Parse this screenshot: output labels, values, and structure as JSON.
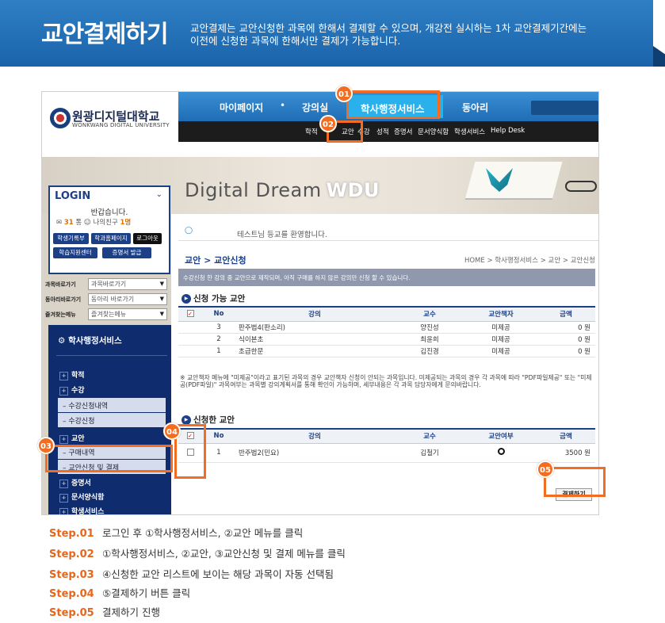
{
  "banner": {
    "title": "교안결제하기",
    "desc_line1": "교안결제는 교안신청한 과목에 한해서 결제할 수 있으며, 개강전 실시하는 1차 교안결제기간에는",
    "desc_line2": "이전에 신청한 과목에 한해서만 결제가 가능합니다."
  },
  "logo": {
    "kr": "원광디지털대학교",
    "en": "WONKWANG DIGITAL UNIVERSITY"
  },
  "gnb": {
    "items": [
      "마이페이지",
      "강의실",
      "학사행정서비스",
      "동아리"
    ],
    "dot": "•"
  },
  "subnav": [
    "학적",
    "교안",
    "수강",
    "성적",
    "증명서",
    "문서양식함",
    "학생서비스",
    "Help Desk"
  ],
  "visual": {
    "text": "Digital Dream",
    "brand": "WDU"
  },
  "login": {
    "title": "LOGIN",
    "chev": "⌄",
    "greeting": "반갑습니다.",
    "count_prefix": "31",
    "count_mid": "통",
    "friend_label": "나의친구",
    "friend_count": "1명",
    "buttons": [
      "학생기록부",
      "학과홈페이지",
      "로그아웃",
      "학습지원센터",
      "증명서 발급"
    ]
  },
  "quick": [
    {
      "label": "과목바로가기",
      "value": "과목바로가기"
    },
    {
      "label": "동아리바로가기",
      "value": "동아리 바로가기"
    },
    {
      "label": "즐겨찾는메뉴",
      "value": "즐겨찾는메뉴"
    }
  ],
  "lnb": {
    "head": "학사행정서비스",
    "items": [
      "학적",
      "수강",
      "교안",
      "증명서",
      "문서양식함",
      "학생서비스"
    ],
    "subs": [
      "수강신청내역",
      "수강신청",
      "구매내역",
      "교안신청 및 결제"
    ]
  },
  "content": {
    "notice": "테스트님 등교를 환영합니다.",
    "crumb_title": "교안 > 교안신청",
    "crumb_path": "HOME > 학사행정서비스 > 교안 > 교안신청",
    "info": "수강신청 한 강의 중 교안으로 제작되며, 아직 구매를 하지 않은 강의만 신청 할 수 있습니다.",
    "sec1": "신청 가능 교안",
    "sec2": "신청한 교안",
    "table1": {
      "headers": [
        "No",
        "강의",
        "교수",
        "교안책자",
        "금액"
      ],
      "rows": [
        [
          "3",
          "판주법4(판소리)",
          "양진성",
          "미제공",
          "0 원"
        ],
        [
          "2",
          "식이본초",
          "최윤희",
          "미제공",
          "0 원"
        ],
        [
          "1",
          "초급한문",
          "김진경",
          "미제공",
          "0 원"
        ]
      ]
    },
    "footnote": "※ 교안책자 메뉴에 \"미제공\"이라고 표기된 과목의 경우 교안책자 신청이 안되는 과목입니다. 미제공되는 과목의 경우 각 과목에 따라 \"PDF파일제공\" 또는 \"미제공(PDF파일)\" 과목여부는 과목별 강의계획서를 통해 확인이 가능하며, 세부내용은 각 과목 담당자에게 문의바랍니다.",
    "table2": {
      "headers": [
        "No",
        "강의",
        "교수",
        "교안여부",
        "금액"
      ],
      "rows": [
        [
          "1",
          "반주법2(민요)",
          "김철기",
          "",
          "3500 원"
        ]
      ]
    },
    "pay_button": "결제하기"
  },
  "badges": [
    "01",
    "02",
    "03",
    "04",
    "05"
  ],
  "steps": [
    {
      "no": "Step.01",
      "text": "로그인 후 ①학사행정서비스, ②교안 메뉴를 클릭"
    },
    {
      "no": "Step.02",
      "text": "①학사행정서비스, ②교안, ③교안신청 및 결제 메뉴를 클릭"
    },
    {
      "no": "Step.03",
      "text": "④신청한 교안 리스트에 보이는 해당 과목이 자동 선택됨"
    },
    {
      "no": "Step.04",
      "text": "⑤결제하기 버튼 클릭"
    },
    {
      "no": "Step.05",
      "text": "결제하기 진행"
    }
  ],
  "colors": {
    "accent": "#f26d21",
    "navy": "#1d3f86",
    "banner": "#1a63aa"
  }
}
